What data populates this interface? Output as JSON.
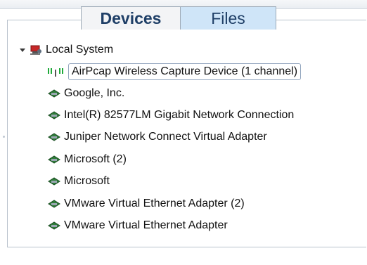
{
  "tabs": {
    "devices_label": "Devices",
    "files_label": "Files"
  },
  "tree": {
    "root": {
      "label": "Local System",
      "expand_icon": "triangle-down-icon",
      "icon": "computer-network-icon"
    },
    "items": [
      {
        "label": "AirPcap Wireless Capture Device (1 channel)",
        "icon": "wireless-antenna-icon",
        "selected": true
      },
      {
        "label": "Google, Inc.",
        "icon": "network-adapter-icon"
      },
      {
        "label": "Intel(R) 82577LM Gigabit Network Connection",
        "icon": "network-adapter-icon"
      },
      {
        "label": "Juniper Network Connect Virtual Adapter",
        "icon": "network-adapter-icon"
      },
      {
        "label": "Microsoft (2)",
        "icon": "network-adapter-icon"
      },
      {
        "label": "Microsoft",
        "icon": "network-adapter-icon"
      },
      {
        "label": "VMware Virtual Ethernet Adapter (2)",
        "icon": "network-adapter-icon"
      },
      {
        "label": "VMware Virtual Ethernet Adapter",
        "icon": "network-adapter-icon"
      }
    ]
  },
  "colors": {
    "tab_text": "#1f3f67",
    "tab_files_bg": "#cfe5f8",
    "border": "#9da9b6"
  }
}
